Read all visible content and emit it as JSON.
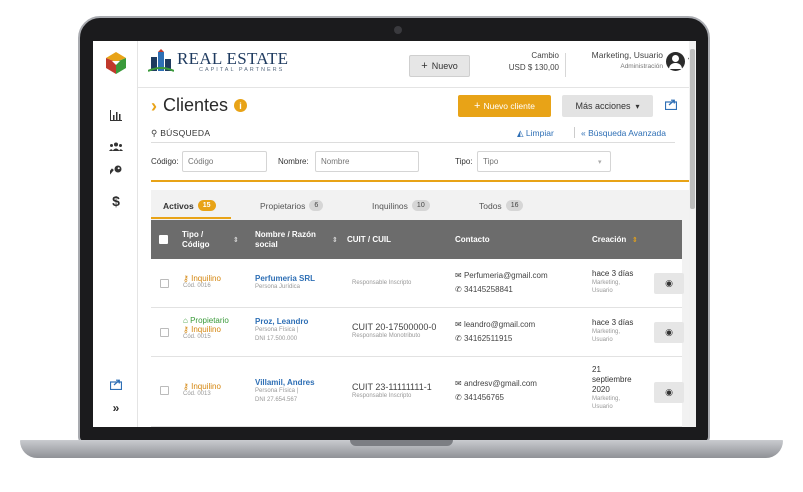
{
  "brand": {
    "name": "REAL ESTATE",
    "tagline": "CAPITAL PARTNERS"
  },
  "header": {
    "new_label": "Nuevo",
    "exchange_title": "Cambio",
    "exchange_value": "USD  $ 130,00",
    "user_name": "Marketing, Usuario",
    "user_role": "Administración"
  },
  "page": {
    "title": "Clientes",
    "new_client_label": "Nuevo cliente",
    "more_actions_label": "Más acciones",
    "search_label": "BÚSQUEDA",
    "clear_label": "Limpiar",
    "advanced_label": "Búsqueda Avanzada"
  },
  "filters": {
    "code_label": "Código:",
    "code_placeholder": "Código",
    "name_label": "Nombre:",
    "name_placeholder": "Nombre",
    "type_label": "Tipo:",
    "type_placeholder": "Tipo"
  },
  "tabs": [
    {
      "label": "Activos",
      "count": "15"
    },
    {
      "label": "Propietarios",
      "count": "6"
    },
    {
      "label": "Inquilinos",
      "count": "10"
    },
    {
      "label": "Todos",
      "count": "16"
    }
  ],
  "table": {
    "headers": {
      "type_line1": "Tipo /",
      "type_line2": "Código",
      "name_line1": "Nombre / Razón",
      "name_line2": "social",
      "cuit": "CUIT / CUIL",
      "contact": "Contacto",
      "created": "Creación"
    },
    "rows": [
      {
        "type1": "Inquilino",
        "type2": "",
        "code": "Cód. 0016",
        "name": "Perfumeria SRL",
        "name_sub1": "Persona Jurídica",
        "name_sub2": "",
        "cuit": "",
        "cuit_sub": "Responsable Inscripto",
        "email": "Perfumeria@gmail.com",
        "phone": "34145258841",
        "date1": "hace 3 días",
        "date2": "",
        "date3": "",
        "date_by1": "Marketing,",
        "date_by2": "Usuario"
      },
      {
        "type1": "Propietario",
        "type2": "Inquilino",
        "code": "Cód. 0015",
        "name": "Proz, Leandro",
        "name_sub1": "Persona Física  |",
        "name_sub2": "DNI  17.500.000",
        "cuit": "CUIT  20-17500000-0",
        "cuit_sub": "Responsable Monotributo",
        "email": "leandro@gmail.com",
        "phone": "34162511915",
        "date1": "hace 3 días",
        "date2": "",
        "date3": "",
        "date_by1": "Marketing,",
        "date_by2": "Usuario"
      },
      {
        "type1": "Inquilino",
        "type2": "",
        "code": "Cód. 0013",
        "name": "Villamil, Andres",
        "name_sub1": "Persona Física  |",
        "name_sub2": "DNI  27.654.567",
        "cuit": "CUIT  23-11111111-1",
        "cuit_sub": "Responsable Inscripto",
        "email": "andresv@gmail.com",
        "phone": "341456765",
        "date1": "21",
        "date2": "septiembre",
        "date3": "2020",
        "date_by1": "Marketing,",
        "date_by2": "Usuario"
      }
    ]
  },
  "colors": {
    "accent": "#e8a317",
    "link": "#2e6fb5",
    "owner": "#3a9a3a",
    "tenant": "#d4860f",
    "table_header": "#6c6c6c"
  }
}
